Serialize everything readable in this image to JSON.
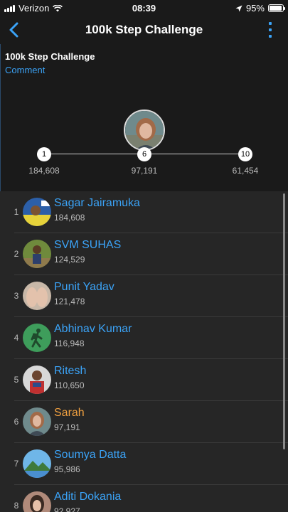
{
  "status": {
    "carrier": "Verizon",
    "time": "08:39",
    "battery": "95%",
    "battery_level": 0.95
  },
  "nav": {
    "title": "100k Step Challenge",
    "back_icon": "chevron-left-icon",
    "more_icon": "vertical-dots-icon"
  },
  "header": {
    "challenge_name": "100k Step Challenge",
    "comment": "Comment"
  },
  "podium": [
    {
      "rank": "1",
      "steps": "184,608"
    },
    {
      "rank": "6",
      "steps": "97,191"
    },
    {
      "rank": "10",
      "steps": "61,454"
    }
  ],
  "leaderboard": [
    {
      "rank": "1",
      "name": "Sagar Jairamuka",
      "steps": "184,608",
      "avatar": "photo-avatar"
    },
    {
      "rank": "2",
      "name": "SVM SUHAS",
      "steps": "124,529",
      "avatar": "photo-avatar"
    },
    {
      "rank": "3",
      "name": "Punit Yadav",
      "steps": "121,478",
      "avatar": "photo-avatar"
    },
    {
      "rank": "4",
      "name": "Abhinav Kumar",
      "steps": "116,948",
      "avatar": "hiker-icon"
    },
    {
      "rank": "5",
      "name": "Ritesh",
      "steps": "110,650",
      "avatar": "photo-avatar"
    },
    {
      "rank": "6",
      "name": "Sarah",
      "steps": "97,191",
      "avatar": "photo-avatar"
    },
    {
      "rank": "7",
      "name": "Soumya Datta",
      "steps": "95,986",
      "avatar": "landscape-avatar"
    },
    {
      "rank": "8",
      "name": "Aditi Dokania",
      "steps": "92,927",
      "avatar": "photo-avatar"
    }
  ],
  "colors": {
    "accent": "#3ba3f7",
    "current_user": "#f0a040",
    "background": "#1a1a1a",
    "list_background": "#262626"
  }
}
